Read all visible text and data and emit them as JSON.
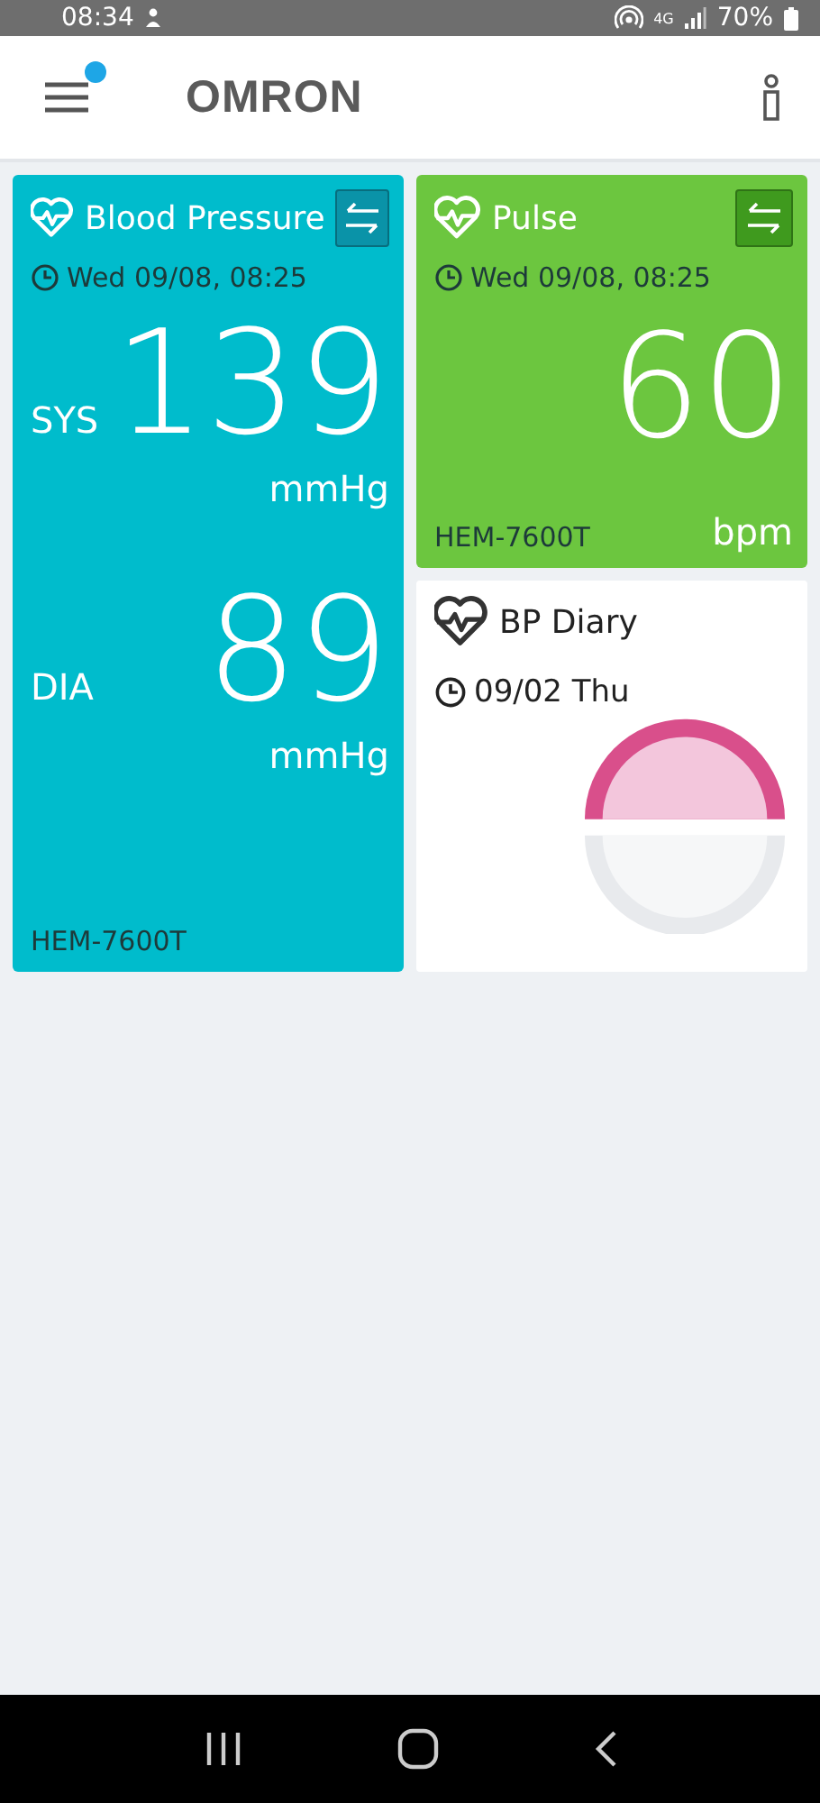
{
  "status_bar": {
    "time": "08:34",
    "network": "4G",
    "battery": "70%"
  },
  "app_bar": {
    "logo": "OMRON",
    "notification_dot": true
  },
  "cards": [
    {
      "kind": "bp",
      "title": "Blood Pressure",
      "color": "#00bccc",
      "time": "Wed 09/08, 08:25",
      "readings": [
        {
          "label": "SYS",
          "value": "139",
          "unit": "mmHg"
        },
        {
          "label": "DIA",
          "value": "89",
          "unit": "mmHg"
        }
      ],
      "device": "HEM-7600T"
    },
    {
      "kind": "pulse",
      "title": "Pulse",
      "color": "#6cc63f",
      "time": "Wed 09/08, 08:25",
      "readings": [
        {
          "value": "60",
          "unit": "bpm"
        }
      ],
      "device": "HEM-7600T"
    }
  ],
  "diary": {
    "title": "BP Diary",
    "date": "09/02 Thu"
  }
}
